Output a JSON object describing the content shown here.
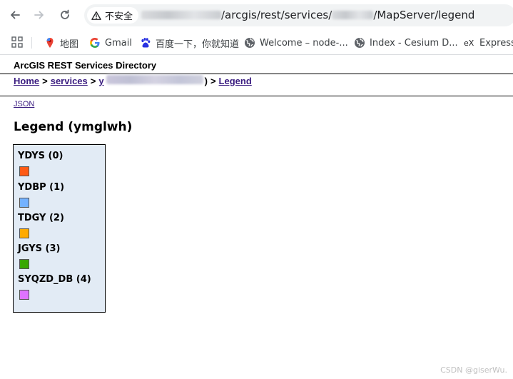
{
  "browser": {
    "security_label": "不安全",
    "url_path": "/arcgis/rest/services/",
    "url_tail": "/MapServer/legend"
  },
  "bookmarks": [
    {
      "label": "地图",
      "icon": "google-maps-icon"
    },
    {
      "label": "Gmail",
      "icon": "google-icon"
    },
    {
      "label": "百度一下，你就知道",
      "icon": "baidu-icon"
    },
    {
      "label": "Welcome – node-...",
      "icon": "globe-icon"
    },
    {
      "label": "Index - Cesium D...",
      "icon": "globe-icon"
    },
    {
      "label": "Express",
      "icon": "express-icon"
    }
  ],
  "page": {
    "directory_title": "ArcGIS REST Services Directory",
    "breadcrumb": {
      "home": "Home",
      "services": "services",
      "service_prefix": "y",
      "legend": "Legend",
      "separator": ">",
      "close_paren": ")"
    },
    "json_link": "JSON",
    "legend_heading": "Legend (ymglwh)"
  },
  "legend": {
    "layers": [
      {
        "name": "YDYS (0)",
        "color": "#ff5a14"
      },
      {
        "name": "YDBP (1)",
        "color": "#73b2ff"
      },
      {
        "name": "TDGY (2)",
        "color": "#ffaa00"
      },
      {
        "name": "JGYS (3)",
        "color": "#38a800"
      },
      {
        "name": "SYQZD_DB (4)",
        "color": "#df73ff"
      }
    ]
  },
  "watermark": "CSDN @giserWu."
}
